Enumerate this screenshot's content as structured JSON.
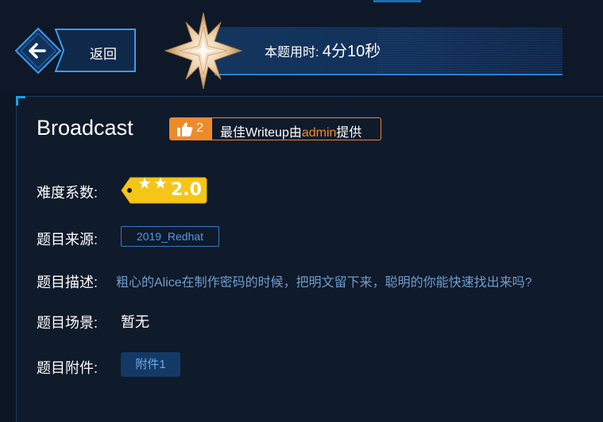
{
  "header": {
    "back_label": "返回",
    "timer_label": "本题用时:",
    "timer_value": "4分10秒"
  },
  "challenge": {
    "title": "Broadcast",
    "writeup": {
      "likes": "2",
      "text_prefix": "最佳Writeup由",
      "user": "admin",
      "text_suffix": "提供"
    },
    "fields": {
      "difficulty_label": "难度系数:",
      "difficulty_value": "2.0",
      "difficulty_stars": 2,
      "source_label": "题目来源:",
      "source_value": "2019_Redhat",
      "description_label": "题目描述:",
      "description_value": "粗心的Alice在制作密码的时候，把明文留下来，聪明的你能快速找出来吗?",
      "scene_label": "题目场景:",
      "scene_value": "暂无",
      "attachment_label": "题目附件:",
      "attachment_value": "附件1"
    }
  },
  "colors": {
    "background": "#0d1624",
    "accent_blue": "#2f7bd1",
    "writeup_orange": "#ed8a2c",
    "difficulty_yellow": "#f5c518",
    "description_text": "#6f9ccc"
  },
  "icons": [
    "back-arrow-icon",
    "compass-star-icon",
    "thumbs-up-icon",
    "star-icon"
  ]
}
